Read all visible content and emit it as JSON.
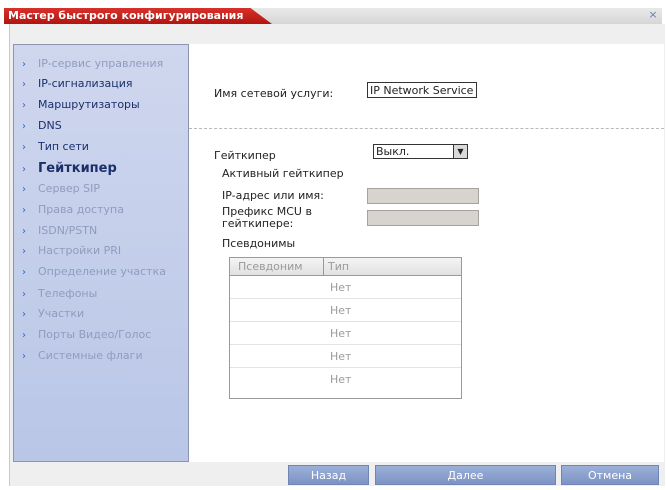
{
  "window": {
    "title": "Мастер быстрого конфигурирования",
    "close_glyph": "×"
  },
  "sidebar": {
    "items": [
      {
        "label": "IP-сервис управления",
        "state": "disabled"
      },
      {
        "label": "IP-сигнализация",
        "state": "enabled"
      },
      {
        "label": "Маршрутизаторы",
        "state": "enabled"
      },
      {
        "label": "DNS",
        "state": "enabled"
      },
      {
        "label": "Тип сети",
        "state": "enabled"
      },
      {
        "label": "Гейткипер",
        "state": "active"
      },
      {
        "label": "Сервер SIP",
        "state": "disabled"
      },
      {
        "label": "Права доступа",
        "state": "disabled"
      },
      {
        "label": "ISDN/PSTN",
        "state": "disabled"
      },
      {
        "label": "Настройки PRI",
        "state": "disabled"
      },
      {
        "label": "Определение участка",
        "state": "disabled"
      },
      {
        "label": "Телефоны",
        "state": "disabled"
      },
      {
        "label": "Участки",
        "state": "disabled"
      },
      {
        "label": "Порты Видео/Голос",
        "state": "disabled"
      },
      {
        "label": "Системные флаги",
        "state": "disabled"
      }
    ],
    "arrow_glyph": "›"
  },
  "form": {
    "service_name_label": "Имя сетевой услуги:",
    "service_name_value": "IP Network Service",
    "gatekeeper_label": "Гейткипер",
    "gatekeeper_value": "Выкл.",
    "active_gatekeeper_label": "Активный гейткипер",
    "ip_label": "IP-адрес или имя:",
    "mcu_prefix_label": "Префикс MCU в гейткипере:",
    "aliases_label": "Псевдонимы"
  },
  "alias_table": {
    "columns": [
      "Псевдоним",
      "Тип"
    ],
    "rows": [
      "Нет",
      "Нет",
      "Нет",
      "Нет",
      "Нет"
    ]
  },
  "footer": {
    "back_label": "Назад",
    "next_label": "Далее",
    "cancel_label": "Отмена"
  },
  "colors": {
    "title_red": "#c4201a",
    "sidebar_bg": "#c3cdea",
    "nav_enabled": "#1b2f6b",
    "nav_disabled": "#8f9cbf",
    "button_blue": "#8aa0cf"
  }
}
